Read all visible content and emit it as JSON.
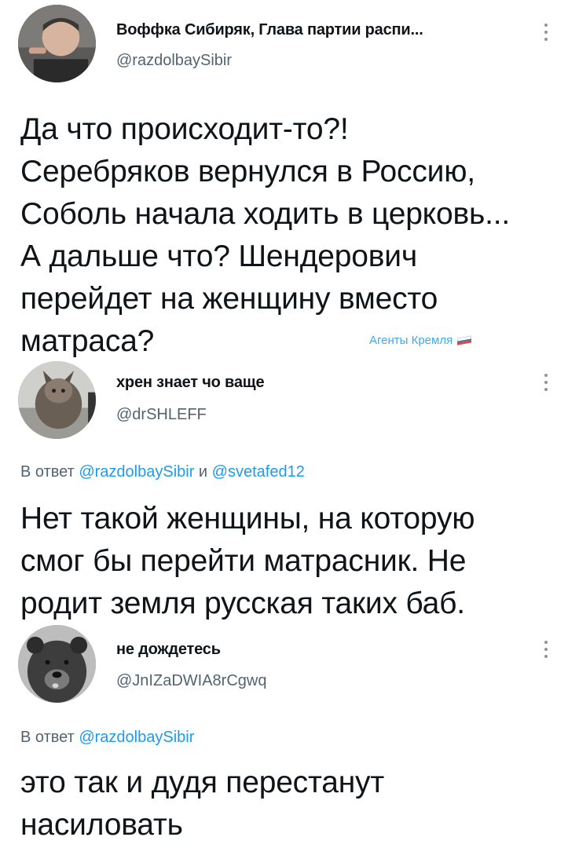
{
  "tweets": [
    {
      "author_name": "Воффка Сибиряк, Глава партии распи...",
      "handle": "@razdolbaySibir",
      "text_lines": [
        "Да что происходит-то?!",
        "Серебряков вернулся в Россию,",
        "Соболь начала ходить в церковь...",
        "А дальше что? Шендерович",
        "перейдет на женщину вместо",
        "матраса?"
      ],
      "stamp": {
        "text": "Агенты Кремля",
        "flag_colors": [
          "#ffffff",
          "#1c57a5",
          "#d52b1e"
        ]
      }
    },
    {
      "author_name": "хрен знает чо ваще",
      "handle": "@drSHLEFF",
      "reply_prefix": "В ответ",
      "reply_mention1": "@razdolbaySibir",
      "reply_and": "и",
      "reply_mention2": "@svetafed12",
      "text_lines": [
        "Нет такой женщины, на которую",
        "смог бы перейти матрасник. Не",
        "родит земля русская таких баб."
      ]
    },
    {
      "author_name": "не дождетесь",
      "handle": "@JnIZaDWIA8rCgwq",
      "reply_prefix": "В ответ",
      "reply_mention1": "@razdolbaySibir",
      "text_lines": [
        "это так и дудя перестанут",
        "насиловать"
      ]
    }
  ],
  "icons": [
    "more-vertical-icon",
    "avatar-photo"
  ],
  "colors": {
    "text": "#0f1419",
    "secondary": "#536471",
    "link": "#1d9bf0"
  }
}
